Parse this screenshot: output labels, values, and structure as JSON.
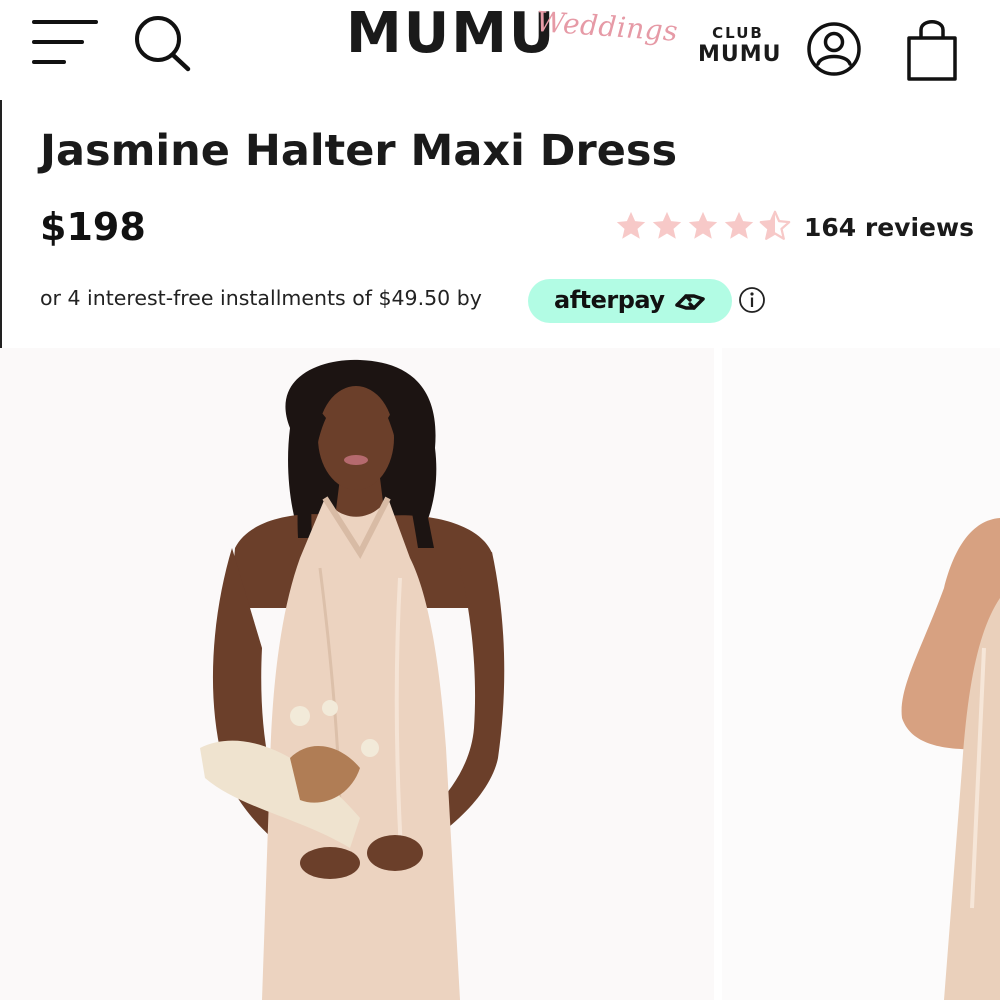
{
  "header": {
    "logo_main": "MUMU",
    "logo_script": "Weddings",
    "club_top": "CLUB",
    "club_bottom": "MUMU",
    "icons": [
      "menu-icon",
      "search-icon",
      "account-icon",
      "shopping-bag-icon"
    ]
  },
  "product": {
    "title": "Jasmine Halter Maxi Dress",
    "price": "$198",
    "rating": 4.5,
    "rating_max": 5,
    "reviews_label": "164 reviews",
    "installments_text": "or 4 interest-free installments of $49.50 by",
    "afterpay_label": "afterpay"
  },
  "colors": {
    "star_color": "#f7c9c8",
    "afterpay_bg": "#b2fce4",
    "logo_script_color": "#e69aa6",
    "dress_color": "#ecd3c0",
    "skin_color": "#6b3f2a"
  },
  "gallery": {
    "images": [
      "product-image-front",
      "product-image-side"
    ]
  }
}
